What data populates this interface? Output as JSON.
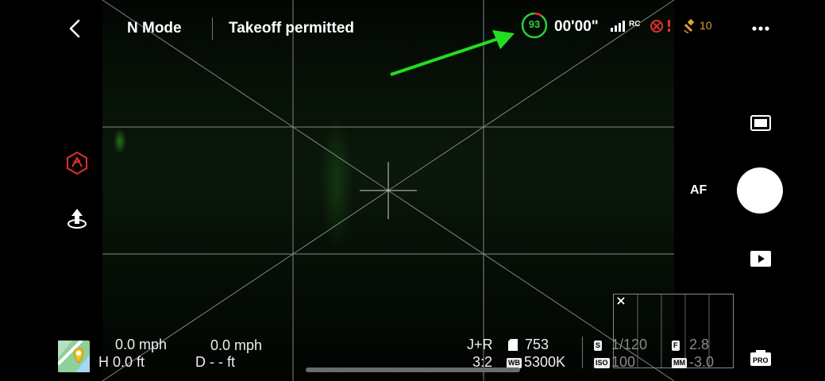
{
  "header": {
    "mode": "N Mode",
    "status": "Takeoff permitted",
    "battery_percent": "93",
    "flight_time": "00'00\"",
    "rc_label": "RC",
    "satellites": "10"
  },
  "right_panel": {
    "af_label": "AF",
    "pro_label": "PRO"
  },
  "telemetry": {
    "h_speed": "0.0 mph",
    "height": "H 0.0 ft",
    "v_speed": "0.0 mph",
    "distance": "D - - ft"
  },
  "camera_info": {
    "format": "J+R",
    "storage_count": "753",
    "aspect": "3:2",
    "wb_badge": "WB",
    "white_balance": "5300K",
    "shutter_badge": "S",
    "shutter": "1/120",
    "aperture_badge": "F",
    "aperture": "2.8",
    "iso_badge": "ISO",
    "iso": "100",
    "ev_badge": "MM",
    "ev": "-3.0"
  },
  "colors": {
    "accent_green": "#2ecc40",
    "warning_red": "#e03030",
    "satellite_orange": "#e0a030",
    "annotation_arrow": "#22dd22"
  }
}
